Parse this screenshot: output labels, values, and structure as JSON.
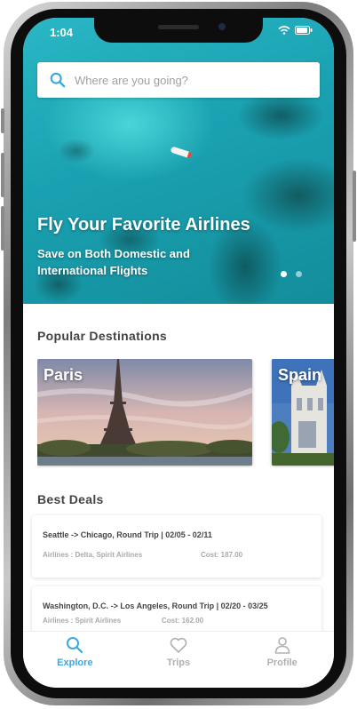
{
  "status_bar": {
    "time": "1:04"
  },
  "search": {
    "placeholder": "Where are you going?"
  },
  "hero": {
    "title": "Fly Your Favorite Airlines",
    "subtitle": "Save on Both Domestic and International Flights"
  },
  "popular": {
    "title": "Popular Destinations",
    "destinations": [
      {
        "name": "Paris"
      },
      {
        "name": "Spain"
      }
    ]
  },
  "deals": {
    "title": "Best Deals",
    "items": [
      {
        "route": "Seattle -> Chicago, Round Trip | 02/05 - 02/11",
        "airlines": "Airlines : Delta, Spirit Airlines",
        "cost": "Cost: 187.00"
      },
      {
        "route": "Washington, D.C. -> Los Angeles, Round Trip | 02/20 - 03/25",
        "airlines": "Airlines : Spirit Airlines",
        "cost": "Cost: 162.00"
      }
    ]
  },
  "tabs": [
    {
      "label": "Explore",
      "icon": "search-icon",
      "active": true
    },
    {
      "label": "Trips",
      "icon": "heart-icon",
      "active": false
    },
    {
      "label": "Profile",
      "icon": "user-icon",
      "active": false
    }
  ],
  "colors": {
    "accent": "#3aa8e0",
    "inactive": "#b0b0b0"
  }
}
